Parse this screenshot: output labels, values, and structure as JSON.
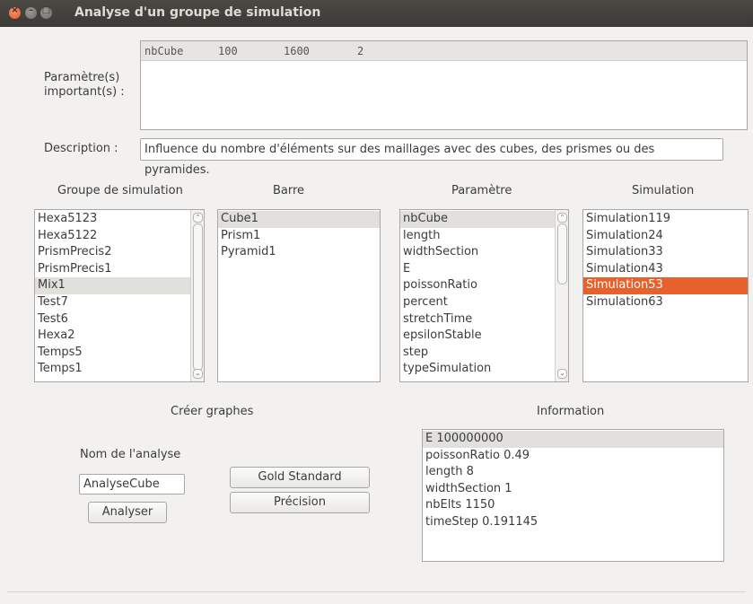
{
  "window": {
    "title": "Analyse d'un groupe de simulation"
  },
  "params": {
    "label": "Paramètre(s)\nimportant(s) :",
    "row": [
      "nbCube",
      "100",
      "1600",
      "2"
    ]
  },
  "description": {
    "label": "Description :",
    "value": "Influence du nombre d'éléments sur des maillages avec des cubes, des prismes ou des pyramides."
  },
  "groups": {
    "header": "Groupe de simulation",
    "items": [
      "Hexa5123",
      "Hexa5122",
      "PrismPrecis2",
      "PrismPrecis1",
      "Mix1",
      "Test7",
      "Test6",
      "Hexa2",
      "Temps5",
      "Temps1"
    ],
    "selected": "Mix1"
  },
  "barre": {
    "header": "Barre",
    "items": [
      "Cube1",
      "Prism1",
      "Pyramid1"
    ],
    "selected": "Cube1"
  },
  "parametre": {
    "header": "Paramètre",
    "items": [
      "nbCube",
      "length",
      "widthSection",
      "E",
      "poissonRatio",
      "percent",
      "stretchTime",
      "epsilonStable",
      "step",
      "typeSimulation"
    ],
    "selected": "nbCube"
  },
  "simulation": {
    "header": "Simulation",
    "items": [
      "Simulation119",
      "Simulation24",
      "Simulation33",
      "Simulation43",
      "Simulation53",
      "Simulation63"
    ],
    "selected": "Simulation53",
    "selected_color": "#e8612c"
  },
  "graphs": {
    "header": "Créer graphes",
    "name_label": "Nom de l'analyse",
    "name_value": "AnalyseCube",
    "analyze_label": "Analyser",
    "gold_label": "Gold Standard",
    "precision_label": "Précision"
  },
  "information": {
    "header": "Information",
    "items": [
      "E 100000000",
      "poissonRatio 0.49",
      "length 8",
      "widthSection 1",
      "nbElts 1150",
      "timeStep 0.191145"
    ],
    "selected": "E 100000000"
  }
}
